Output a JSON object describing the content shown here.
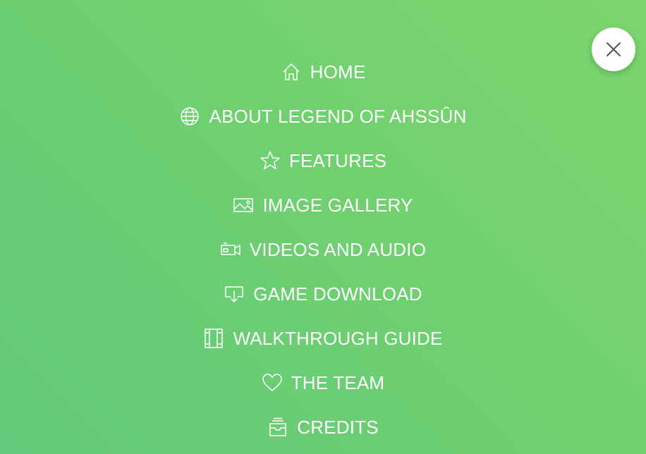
{
  "navigation": {
    "close_icon": "close-icon",
    "items": [
      {
        "label": "HOME",
        "icon": "home-icon"
      },
      {
        "label": "ABOUT LEGEND OF AHSSÛN",
        "icon": "globe-icon"
      },
      {
        "label": "FEATURES",
        "icon": "star-icon"
      },
      {
        "label": "IMAGE GALLERY",
        "icon": "image-icon"
      },
      {
        "label": "VIDEOS AND AUDIO",
        "icon": "video-camera-icon"
      },
      {
        "label": "GAME DOWNLOAD",
        "icon": "download-icon"
      },
      {
        "label": "WALKTHROUGH GUIDE",
        "icon": "book-icon"
      },
      {
        "label": "THE TEAM",
        "icon": "heart-icon"
      },
      {
        "label": "CREDITS",
        "icon": "archive-tray-icon"
      }
    ]
  },
  "colors": {
    "background_start": "#7ed56f",
    "background_end": "#63c97a",
    "text": "#ffffff",
    "close_button": "#ffffff",
    "close_icon": "#555555"
  }
}
